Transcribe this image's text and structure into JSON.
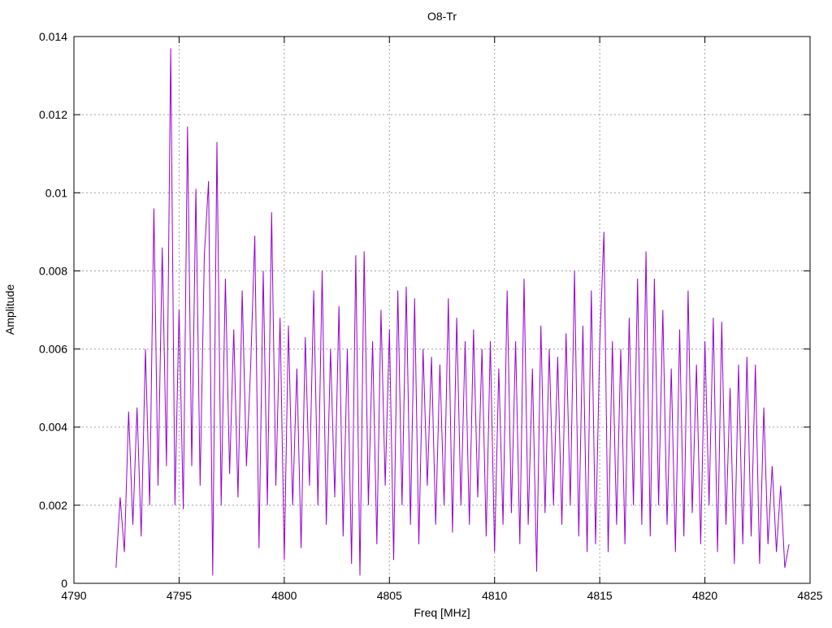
{
  "chart_data": {
    "type": "line",
    "title": "O8-Tr",
    "xlabel": "Freq [MHz]",
    "ylabel": "Amplitude",
    "xlim": [
      4790,
      4825
    ],
    "ylim": [
      0,
      0.014
    ],
    "xticks": [
      "4790",
      "4795",
      "4800",
      "4805",
      "4810",
      "4815",
      "4820",
      "4825"
    ],
    "yticks": [
      "0",
      "0.002",
      "0.004",
      "0.006",
      "0.008",
      "0.01",
      "0.012",
      "0.014"
    ],
    "grid": true,
    "legend": "none",
    "series": [
      {
        "name": "O8-Tr",
        "color": "#9400d3",
        "x_start": 4792,
        "x_step": 0.2,
        "values": [
          0.0004,
          0.0022,
          0.0008,
          0.0044,
          0.0015,
          0.0045,
          0.0012,
          0.006,
          0.002,
          0.0096,
          0.0025,
          0.0086,
          0.003,
          0.0137,
          0.002,
          0.007,
          0.0019,
          0.0117,
          0.003,
          0.0101,
          0.0025,
          0.0084,
          0.0103,
          0.0002,
          0.0113,
          0.002,
          0.0078,
          0.0028,
          0.0065,
          0.0022,
          0.0075,
          0.003,
          0.0055,
          0.0089,
          0.0009,
          0.008,
          0.002,
          0.0095,
          0.0025,
          0.0068,
          0.0006,
          0.0066,
          0.002,
          0.0055,
          0.0009,
          0.0063,
          0.0025,
          0.0075,
          0.002,
          0.008,
          0.0015,
          0.006,
          0.0022,
          0.0071,
          0.0012,
          0.006,
          0.0005,
          0.0084,
          0.0002,
          0.0085,
          0.002,
          0.0062,
          0.001,
          0.007,
          0.0025,
          0.0065,
          0.0006,
          0.0075,
          0.002,
          0.0076,
          0.0015,
          0.0073,
          0.001,
          0.006,
          0.0025,
          0.0058,
          0.0015,
          0.0056,
          0.002,
          0.0073,
          0.0013,
          0.0068,
          0.002,
          0.0062,
          0.0015,
          0.0065,
          0.0022,
          0.006,
          0.0012,
          0.0062,
          0.0008,
          0.0055,
          0.0015,
          0.0075,
          0.0018,
          0.0062,
          0.001,
          0.0078,
          0.0015,
          0.0055,
          0.0003,
          0.0066,
          0.0018,
          0.006,
          0.002,
          0.0058,
          0.0015,
          0.0064,
          0.002,
          0.008,
          0.0012,
          0.0066,
          0.0008,
          0.0075,
          0.001,
          0.0061,
          0.009,
          0.0008,
          0.0062,
          0.0015,
          0.006,
          0.001,
          0.0068,
          0.002,
          0.0078,
          0.0015,
          0.0085,
          0.0012,
          0.0078,
          0.002,
          0.007,
          0.0015,
          0.0055,
          0.0008,
          0.0065,
          0.0012,
          0.0075,
          0.0018,
          0.0056,
          0.001,
          0.0062,
          0.002,
          0.0068,
          0.0008,
          0.0067,
          0.0015,
          0.005,
          0.0005,
          0.0056,
          0.001,
          0.0058,
          0.0012,
          0.0056,
          0.0005,
          0.0045,
          0.001,
          0.003,
          0.0008,
          0.0025,
          0.0004,
          0.001
        ]
      }
    ]
  }
}
